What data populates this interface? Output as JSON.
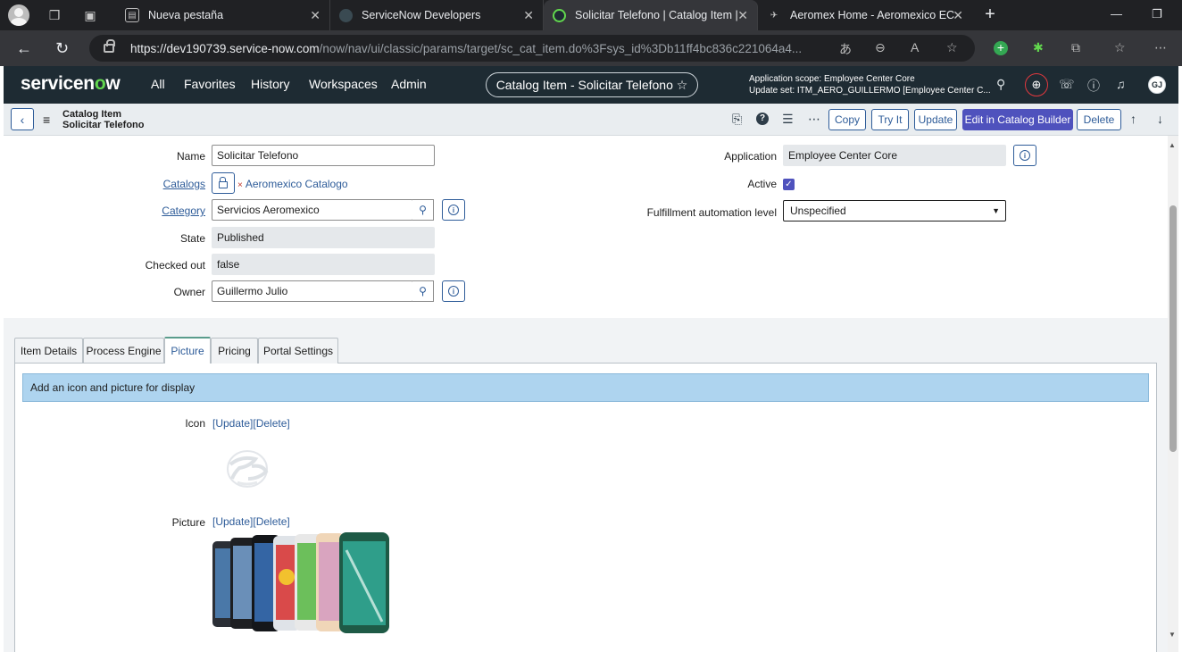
{
  "browser": {
    "tabs": [
      {
        "title": "Nueva pestaña",
        "favicon": "page-icon"
      },
      {
        "title": "ServiceNow Developers",
        "favicon": "servicenow-dev-icon"
      },
      {
        "title": "Solicitar Telefono | Catalog Item |",
        "favicon": "servicenow-icon"
      },
      {
        "title": "Aeromex Home - Aeromexico EC",
        "favicon": "aeromexico-icon"
      }
    ],
    "url_host": "https://dev190739.service-now.com",
    "url_path": "/now/nav/ui/classic/params/target/sc_cat_item.do%3Fsys_id%3Db11ff4bc836c221064a4..."
  },
  "sn_header": {
    "logo_a": "servicen",
    "logo_o": "o",
    "logo_b": "w",
    "menu": [
      "All",
      "Favorites",
      "History",
      "Workspaces",
      "Admin"
    ],
    "pill": "Catalog Item - Solicitar Telefono ☆",
    "scope_line": "Application scope: Employee Center Core",
    "update_set_line": "Update set: ITM_AERO_GUILLERMO [Employee Center C...",
    "user_initials": "GJ"
  },
  "record": {
    "type": "Catalog Item",
    "name": "Solicitar Telefono",
    "buttons": {
      "copy": "Copy",
      "try_it": "Try It",
      "update": "Update",
      "edit_builder": "Edit in Catalog Builder",
      "delete": "Delete"
    }
  },
  "form": {
    "name_label": "Name",
    "name_value": "Solicitar Telefono",
    "catalogs_label": "Catalogs",
    "catalogs_value": "Aeromexico Catalogo",
    "category_label": "Category",
    "category_value": "Servicios Aeromexico",
    "state_label": "State",
    "state_value": "Published",
    "checked_out_label": "Checked out",
    "checked_out_value": "false",
    "owner_label": "Owner",
    "owner_value": "Guillermo Julio",
    "application_label": "Application",
    "application_value": "Employee Center Core",
    "active_label": "Active",
    "active_value": true,
    "fulfillment_label": "Fulfillment automation level",
    "fulfillment_value": "Unspecified"
  },
  "tabs": [
    {
      "label": "Item Details",
      "active": false
    },
    {
      "label": "Process Engine",
      "active": false
    },
    {
      "label": "Picture",
      "active": true
    },
    {
      "label": "Pricing",
      "active": false
    },
    {
      "label": "Portal Settings",
      "active": false
    }
  ],
  "picture_tab": {
    "info": "Add an icon and picture for display",
    "icon_label": "Icon",
    "picture_label": "Picture",
    "update_link": "[Update]",
    "delete_link": "[Delete]"
  },
  "colors": {
    "sn_header": "#1e2b33",
    "primary_button": "#4f52bd",
    "link": "#2e5c99",
    "info_bar": "#aed4ef"
  }
}
